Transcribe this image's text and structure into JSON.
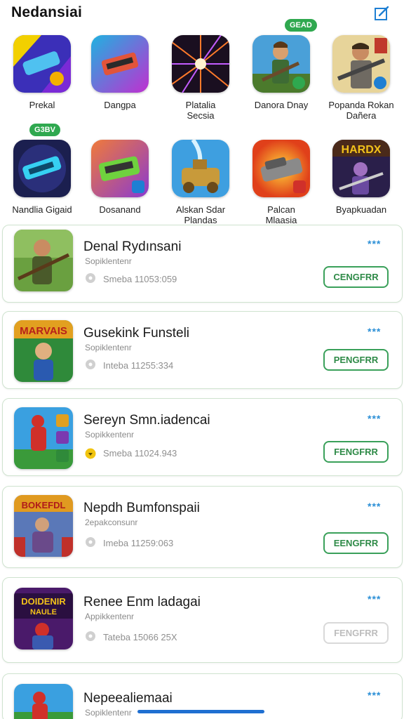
{
  "header": {
    "title": "Nedansiai",
    "edit_icon": "edit-square-icon"
  },
  "featured": [
    {
      "name": "Prekal",
      "badge": ""
    },
    {
      "name": "Dangpa",
      "badge": ""
    },
    {
      "name": "Platalia\nSecsia",
      "badge": ""
    },
    {
      "name": "Danora Dnay",
      "badge": "GEAD"
    },
    {
      "name": "Popanda Rokan\nDañera",
      "badge": ""
    },
    {
      "name": "Nandlia Gigaid",
      "badge": "G3BV"
    },
    {
      "name": "Dosanand",
      "badge": ""
    },
    {
      "name": "Alskan Sdar\nPlandas",
      "badge": ""
    },
    {
      "name": "Palcan\nMlaasia",
      "badge": ""
    },
    {
      "name": "Byapkuadan",
      "badge": ""
    }
  ],
  "list": [
    {
      "title": "Denal Rydınsani",
      "subtitle": "Sopiklentenr",
      "meta": "Smeba 11053:059",
      "stars": "***",
      "button": "CENGFRR",
      "pin_color": "#c9c9c9"
    },
    {
      "title": "Gusekink Funsteli",
      "subtitle": "Sopiklentenr",
      "meta": "Inteba 11255:334",
      "stars": "***",
      "button": "PENGFRR",
      "pin_color": "#c9c9c9"
    },
    {
      "title": "Sereyn Smn.iadencai",
      "subtitle": "Sopikkentenr",
      "meta": "Smeba 11024.943",
      "stars": "***",
      "button": "FENGFRR",
      "pin_color": "#f1c40f"
    },
    {
      "title": "Nepdh Bumfonspaii",
      "subtitle": "2epakconsunr",
      "meta": "Imeba 11259:063",
      "stars": "***",
      "button": "EENGFRR",
      "pin_color": "#c9c9c9"
    },
    {
      "title": "Renee Enm ladagai",
      "subtitle": "Appikkentenr",
      "meta": "Tateba 15066 25X",
      "stars": "***",
      "button": "FENGFRR",
      "pin_color": "#c9c9c9"
    },
    {
      "title": "Nepeealiemaai",
      "subtitle": "Sopiklentenr",
      "meta": "",
      "stars": "***",
      "button": "",
      "pin_color": "#c9c9c9"
    }
  ]
}
